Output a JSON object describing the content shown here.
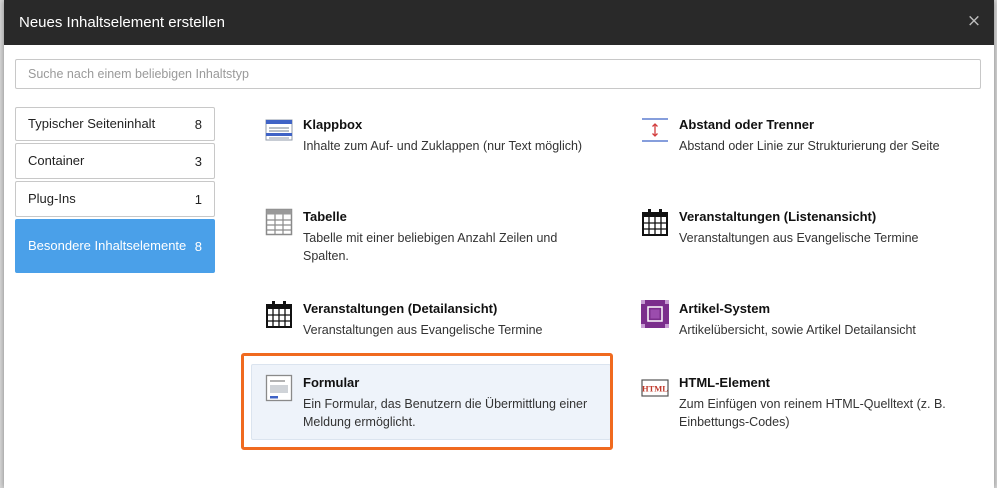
{
  "modal": {
    "title": "Neues Inhaltselement erstellen",
    "close_symbol": "×"
  },
  "search": {
    "placeholder": "Suche nach einem beliebigen Inhaltstyp",
    "value": ""
  },
  "tabs": [
    {
      "label": "Typischer Seiteninhalt",
      "count": "8",
      "active": false
    },
    {
      "label": "Container",
      "count": "3",
      "active": false
    },
    {
      "label": "Plug-Ins",
      "count": "1",
      "active": false
    },
    {
      "label": "Besondere Inhaltselemente",
      "count": "8",
      "active": true
    }
  ],
  "items": [
    {
      "title": "Klappbox",
      "description": "Inhalte zum Auf- und Zuklappen (nur Text möglich)",
      "icon": "accordion-icon"
    },
    {
      "title": "Abstand oder Trenner",
      "description": "Abstand oder Linie zur Strukturierung der Seite",
      "icon": "divider-icon"
    },
    {
      "title": "Tabelle",
      "description": "Tabelle mit einer beliebigen Anzahl Zeilen und Spalten.",
      "icon": "table-icon"
    },
    {
      "title": "Veranstaltungen (Listenansicht)",
      "description": "Veranstaltungen aus Evangelische Termine",
      "icon": "calendar-icon"
    },
    {
      "title": "Veranstaltungen (Detailansicht)",
      "description": "Veranstaltungen aus Evangelische Termine",
      "icon": "calendar-icon"
    },
    {
      "title": "Artikel-System",
      "description": "Artikelübersicht, sowie Artikel Detailansicht",
      "icon": "article-system-icon"
    },
    {
      "title": "Formular",
      "description": "Ein Formular, das Benutzern die Übermittlung einer Meldung ermöglicht.",
      "icon": "form-icon",
      "highlighted": true
    },
    {
      "title": "HTML-Element",
      "description": "Zum Einfügen von reinem HTML-Quelltext (z. B. Einbettungs-Codes)",
      "icon": "html-icon",
      "icon_text": "HTML"
    }
  ],
  "colors": {
    "header_bg": "#292929",
    "active_tab": "#4aa0e9",
    "highlight_border": "#f06a1f",
    "article_icon": "#7b2e8c",
    "html_icon_text": "#c0392b"
  }
}
